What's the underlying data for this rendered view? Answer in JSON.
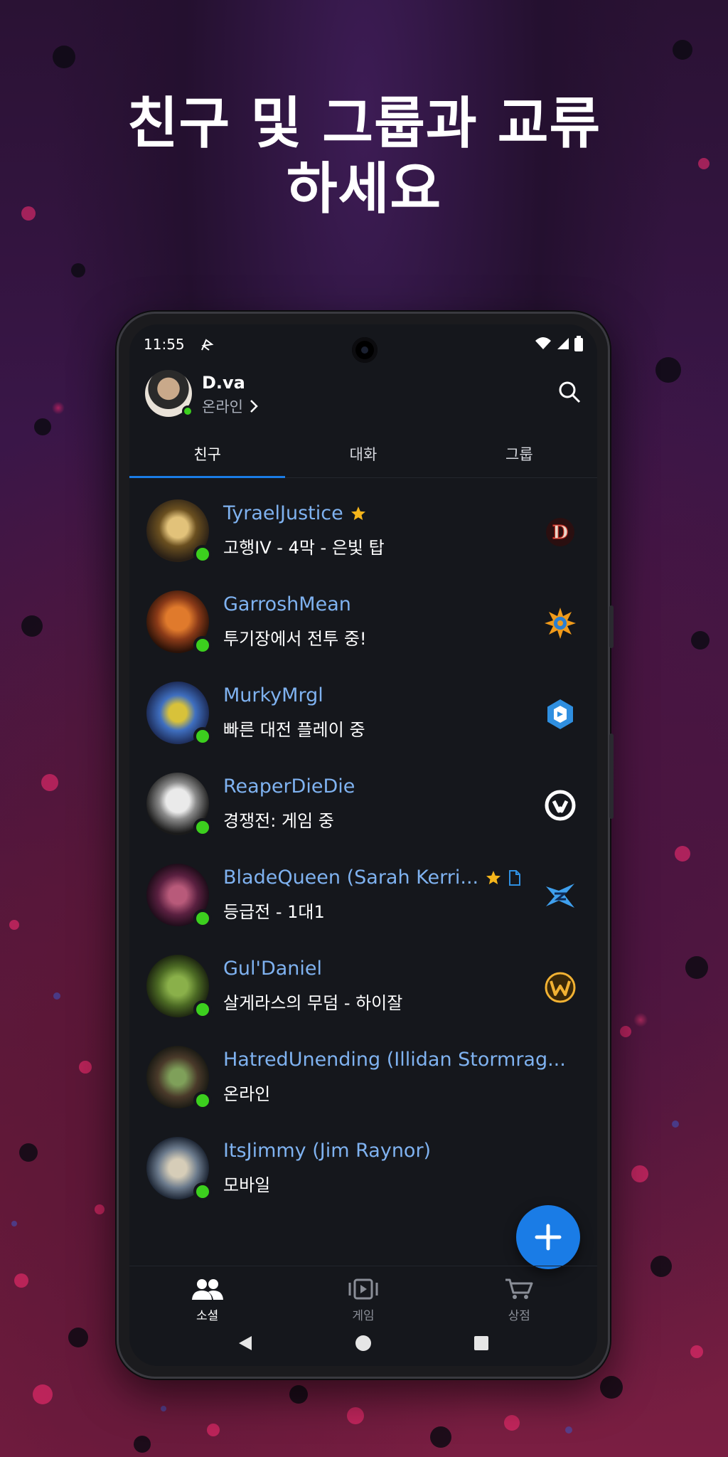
{
  "headline": {
    "line1": "친구 및 그룹과 교류",
    "line2": "하세요"
  },
  "status_bar": {
    "time": "11:55"
  },
  "profile": {
    "name": "D.va",
    "status": "온라인"
  },
  "tabs": [
    {
      "label": "친구",
      "active": true
    },
    {
      "label": "대화",
      "active": false
    },
    {
      "label": "그룹",
      "active": false
    }
  ],
  "friends": [
    {
      "name": "TyraelJustice",
      "status": "고행IV - 4막 - 은빛 탑",
      "star": true,
      "note": false,
      "game_icon": "diablo-icon",
      "online": true
    },
    {
      "name": "GarroshMean",
      "status": "투기장에서 전투 중!",
      "star": false,
      "note": false,
      "game_icon": "hearthstone-icon",
      "online": true
    },
    {
      "name": "MurkyMrgl",
      "status": "빠른 대전 플레이 중",
      "star": false,
      "note": false,
      "game_icon": "heroes-icon",
      "online": true
    },
    {
      "name": "ReaperDieDie",
      "status": "경쟁전: 게임 중",
      "star": false,
      "note": false,
      "game_icon": "overwatch-icon",
      "online": true
    },
    {
      "name": "BladeQueen (Sarah Kerri...",
      "status": "등급전 - 1대1",
      "star": true,
      "note": true,
      "game_icon": "starcraft-icon",
      "online": true
    },
    {
      "name": "Gul'Daniel",
      "status": "살게라스의 무덤 - 하이잘",
      "star": false,
      "note": false,
      "game_icon": "warcraft-icon",
      "online": true
    },
    {
      "name": "HatredUnending (Illidan Stormrag...",
      "status": "온라인",
      "star": false,
      "note": false,
      "game_icon": "",
      "online": true
    },
    {
      "name": "ItsJimmy (Jim Raynor)",
      "status": "모바일",
      "star": false,
      "note": false,
      "game_icon": "",
      "online": true
    }
  ],
  "bottom_nav": [
    {
      "label": "소셜",
      "icon": "social-icon",
      "active": true
    },
    {
      "label": "게임",
      "icon": "games-icon",
      "active": false
    },
    {
      "label": "상점",
      "icon": "shop-icon",
      "active": false
    }
  ],
  "colors": {
    "accent": "#1a7ce6",
    "online": "#3ccf1e",
    "friend_name": "#7fb2f0",
    "star": "#f5b51b"
  }
}
